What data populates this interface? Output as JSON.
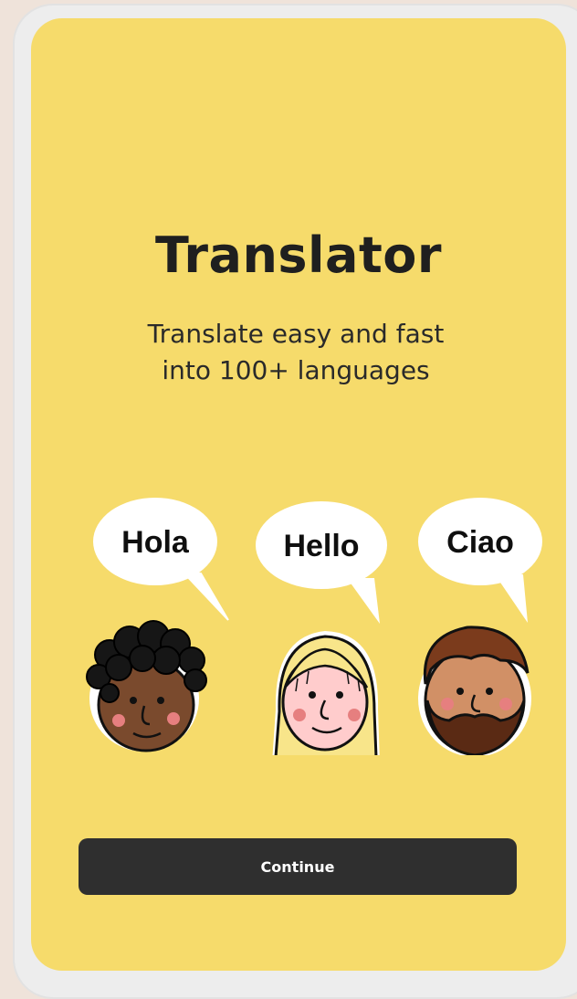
{
  "app": {
    "title": "Translator",
    "subtitle_lines": [
      "Translate easy and fast",
      "into 100+ languages"
    ]
  },
  "greetings": [
    {
      "text": "Hola"
    },
    {
      "text": "Hello"
    },
    {
      "text": "Ciao"
    }
  ],
  "actions": {
    "continue_label": "Continue"
  },
  "colors": {
    "background": "#f6db6b",
    "button": "#2f2f2f",
    "button_text": "#ffffff",
    "page": "#efe3da"
  }
}
